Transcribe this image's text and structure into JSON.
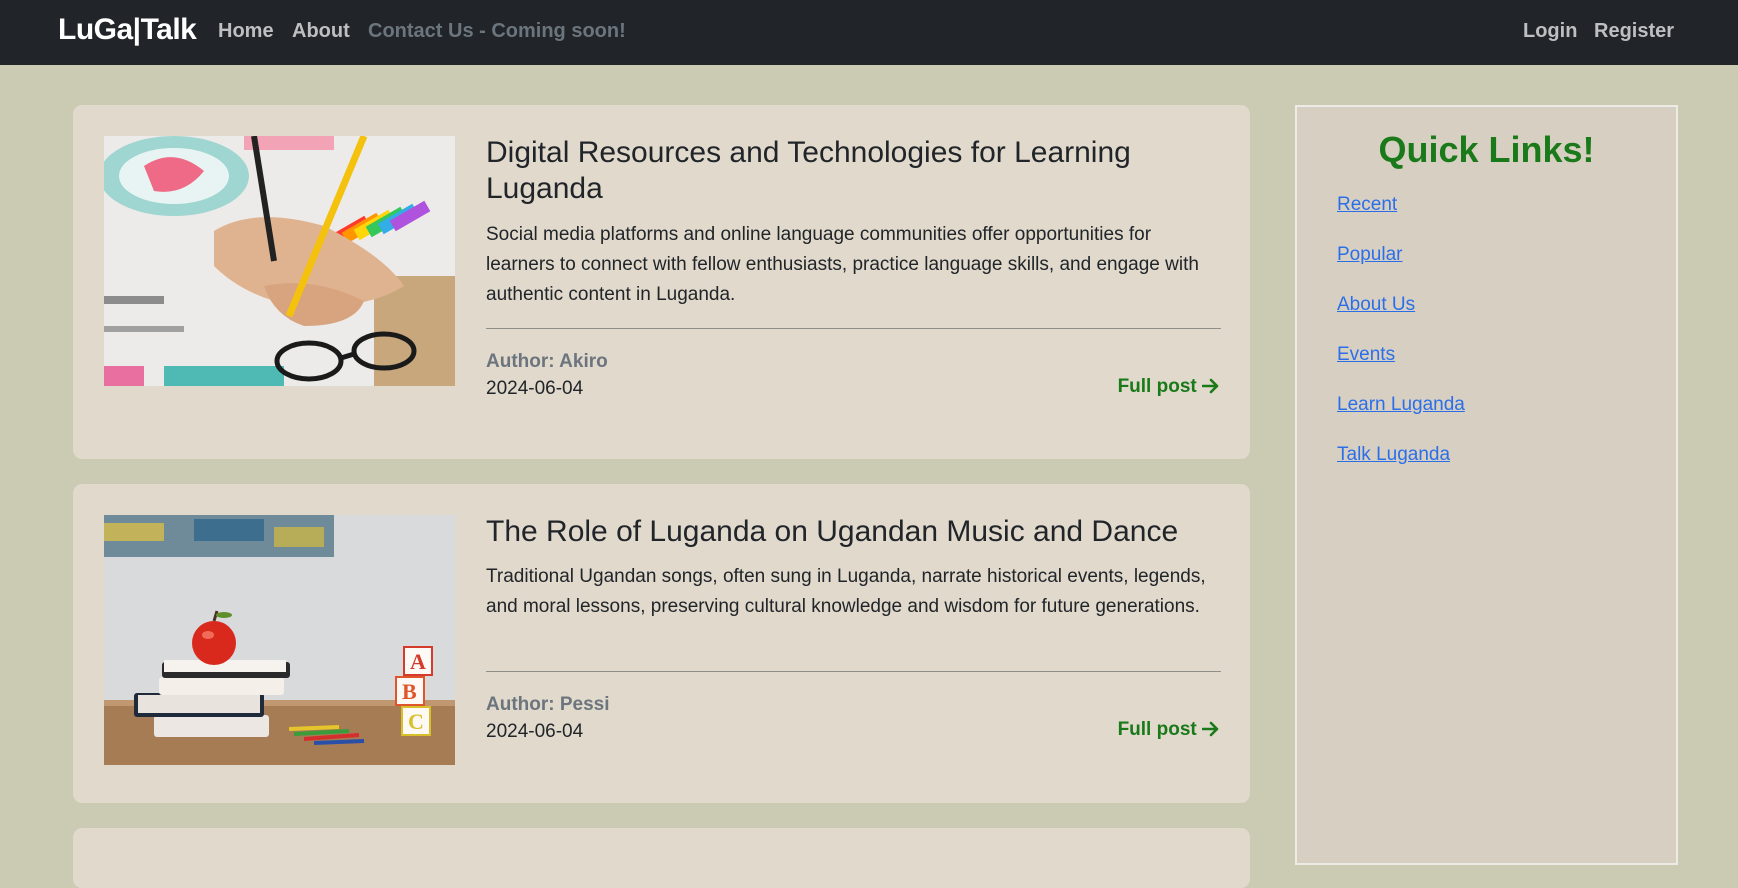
{
  "navbar": {
    "brand": "LuGa|Talk",
    "links": [
      {
        "label": "Home"
      },
      {
        "label": "About"
      },
      {
        "label": "Contact Us - Coming soon!"
      }
    ],
    "login_label": "Login",
    "register_label": "Register"
  },
  "posts": [
    {
      "title": "Digital Resources and Technologies for Learning Luganda",
      "excerpt": "Social media platforms and online language communities offer opportunities for learners to connect with fellow enthusiasts, practice language skills, and engage with authentic content in Luganda.",
      "author": "Author: Akiro",
      "date": "2024-06-04",
      "link_label": "Full post"
    },
    {
      "title": "The Role of Luganda on Ugandan Music and Dance",
      "excerpt": "Traditional Ugandan songs, often sung in Luganda, narrate historical events, legends, and moral lessons, preserving cultural knowledge and wisdom for future generations.",
      "author": "Author: Pessi",
      "date": "2024-06-04",
      "link_label": "Full post"
    }
  ],
  "sidebar": {
    "title": "Quick Links!",
    "links": [
      {
        "label": "Recent"
      },
      {
        "label": "Popular"
      },
      {
        "label": "About Us"
      },
      {
        "label": "Events"
      },
      {
        "label": "Learn Luganda"
      },
      {
        "label": "Talk Luganda"
      }
    ]
  },
  "colors": {
    "page_bg": "#cbcab2",
    "navbar_bg": "#212529",
    "card_bg": "#e0d9cc",
    "accent_green": "#1a7a1a",
    "link_blue": "#2b6fe8"
  }
}
